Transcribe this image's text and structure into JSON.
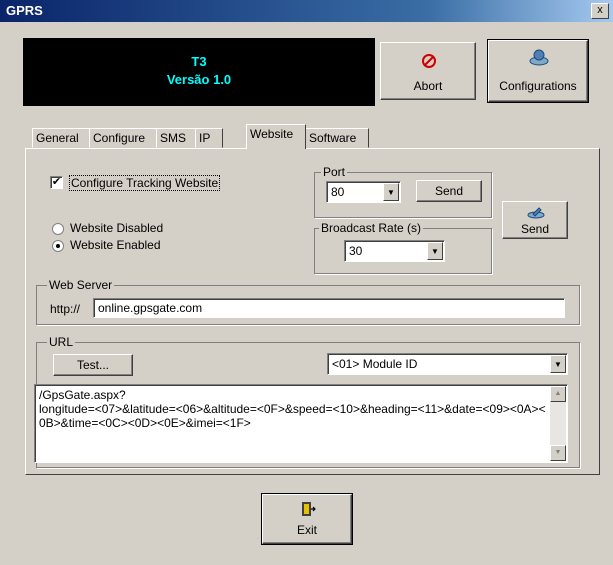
{
  "window": {
    "title": "GPRS",
    "close_label": "x"
  },
  "display": {
    "line1": "T3",
    "line2": "Versão 1.0"
  },
  "toolbar": {
    "abort_label": "Abort",
    "configurations_label": "Configurations",
    "exit_label": "Exit"
  },
  "tabs": [
    {
      "label": "General"
    },
    {
      "label": "Configure"
    },
    {
      "label": "SMS"
    },
    {
      "label": "IP"
    },
    {
      "label": "Website",
      "active": true
    },
    {
      "label": "Software"
    }
  ],
  "website": {
    "configure_tracking_label": "Configure Tracking Website",
    "configure_tracking_checked": true,
    "website_disabled_label": "Website Disabled",
    "website_enabled_label": "Website Enabled",
    "website_enabled": true,
    "port_label": "Port",
    "port_value": "80",
    "port_send_label": "Send",
    "broadcast_rate_label": "Broadcast Rate (s)",
    "broadcast_rate_value": "30",
    "send_label": "Send",
    "web_server_label": "Web Server",
    "http_prefix": "http://",
    "web_server_value": "online.gpsgate.com",
    "url_label": "URL",
    "test_label": "Test...",
    "module_select_value": "<01> Module ID",
    "url_text": "/GpsGate.aspx?\nlongitude=<07>&latitude=<06>&altitude=<0F>&speed=<10>&heading=<11>&date=<09><0A><0B>&time=<0C><0D><0E>&imei=<1F>"
  },
  "colors": {
    "display_bg": "#000000",
    "display_text": "#00ffff",
    "window_bg": "#d4d0c8",
    "title_bar": "#0a246a"
  }
}
